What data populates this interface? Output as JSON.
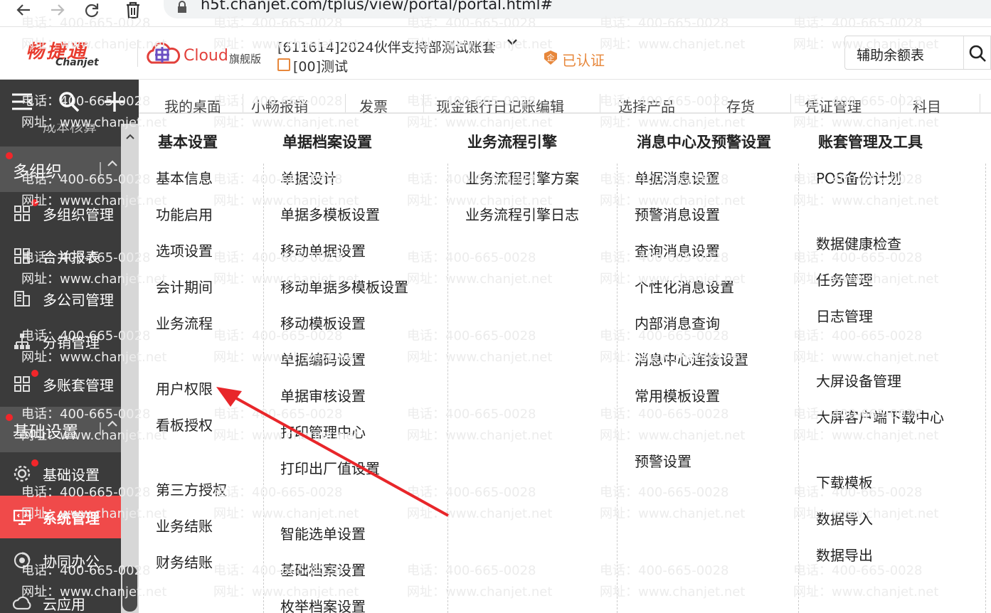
{
  "browser": {
    "url": "h5t.chanjet.com/tplus/view/portal/portal.html#"
  },
  "header": {
    "logo_cn": "畅捷通",
    "logo_en": "Chanjet",
    "cloud_label": "Cloud",
    "edition": "旗舰版",
    "account": "[611614]2024伙伴支持部测试账套",
    "org": "[00]测试",
    "certified": "已认证",
    "search_value": "辅助余额表"
  },
  "sidebar": {
    "cut_item": "成本核算",
    "groups": [
      {
        "label": "多组织"
      },
      {
        "label": "基础设置"
      }
    ],
    "items": [
      {
        "label": "多组织管理"
      },
      {
        "label": "合并报表"
      },
      {
        "label": "多公司管理"
      },
      {
        "label": "分销管理"
      },
      {
        "label": "多账套管理"
      },
      {
        "label": "基础设置"
      },
      {
        "label": "系统管理"
      },
      {
        "label": "协同办公"
      },
      {
        "label": "云应用"
      }
    ]
  },
  "tabs": [
    "我的桌面",
    "小畅报销",
    "发票",
    "现金银行日记账编辑",
    "选择产品",
    "存货",
    "凭证管理",
    "科目"
  ],
  "menu": {
    "columns": [
      {
        "title": "基本设置",
        "items": [
          "基本信息",
          "功能启用",
          "选项设置",
          "会计期间",
          "业务流程",
          "用户权限",
          "看板授权",
          "第三方授权",
          "业务结账",
          "财务结账"
        ]
      },
      {
        "title": "单据档案设置",
        "items": [
          "单据设计",
          "单据多模板设置",
          "移动单据设置",
          "移动单据多模板设置",
          "移动模板设置",
          "单据编码设置",
          "单据审核设置",
          "打印管理中心",
          "打印出厂值设置",
          "智能选单设置",
          "基础档案设置",
          "枚举档案设置"
        ]
      },
      {
        "title": "业务流程引擎",
        "items": [
          "业务流程引擎方案",
          "业务流程引擎日志"
        ]
      },
      {
        "title": "消息中心及预警设置",
        "items": [
          "单据消息设置",
          "预警消息设置",
          "查询消息设置",
          "个性化消息设置",
          "内部消息查询",
          "消息中心连接设置",
          "常用模板设置",
          "预警设置"
        ]
      },
      {
        "title": "账套管理及工具",
        "items": [
          "POS备份计划",
          "数据健康检查",
          "任务管理",
          "日志管理",
          "大屏设备管理",
          "大屏客户端下载中心",
          "下载模板",
          "数据导入",
          "数据导出"
        ]
      }
    ]
  },
  "watermark": {
    "phone": "电话：400-665-0028",
    "site": "网址：www.chanjet.net"
  }
}
